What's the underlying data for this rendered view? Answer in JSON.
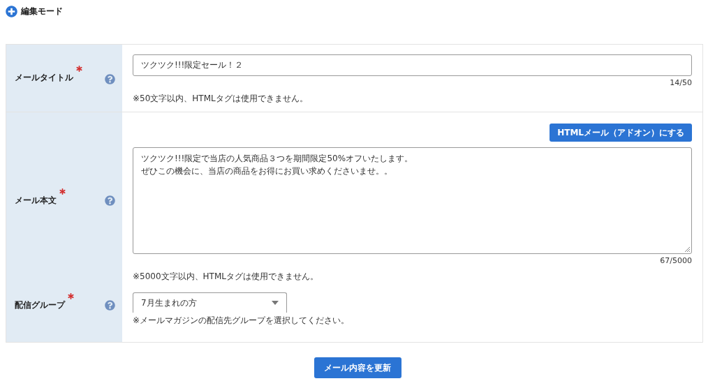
{
  "header": {
    "title": "編集モード"
  },
  "fields": [
    {
      "kind": "text",
      "label": "メールタイトル",
      "required": true,
      "value": "ツクツク!!!限定セール！２",
      "counter": "14/50",
      "note": "※50文字以内、HTMLタグは使用できません。"
    },
    {
      "kind": "textarea",
      "label": "メール本文",
      "required": true,
      "action": "HTMLメール（アドオン）にする",
      "lines": [
        "ツクツク!!!限定で当店の人気商品３つを期間限定50%オフいたします。",
        "ぜひこの機会に、当店の商品をお得にお買い求めくださいませ。。"
      ],
      "counter": "67/5000",
      "note": "※5000文字以内、HTMLタグは使用できません。"
    },
    {
      "kind": "select",
      "label": "配信グループ",
      "required": true,
      "value": "7月生まれの方",
      "note": "※メールマガジンの配信先グループを選択してください。"
    }
  ],
  "submit": "メール内容を更新"
}
